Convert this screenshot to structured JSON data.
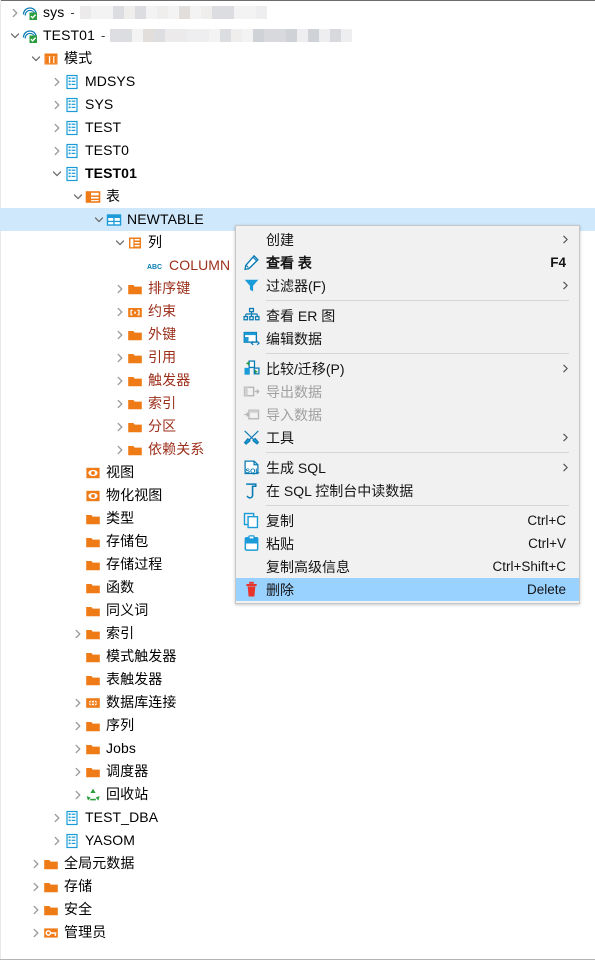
{
  "window": {
    "title": "Database Navigator",
    "selection_color": "#cfe8fc",
    "menu_highlight_color": "#99d1ff",
    "accent_orange": "#ef7b16",
    "accent_blue": "#1b9bd8",
    "schema_text_color": "#9c2f1b"
  },
  "tree": {
    "items": [
      {
        "label": "sys",
        "indent": 0,
        "twisty": "collapsed",
        "icon": "connection-icon",
        "bold": false,
        "red": false,
        "censored": true,
        "dash": true
      },
      {
        "label": "TEST01",
        "indent": 0,
        "twisty": "expanded",
        "icon": "connection-icon",
        "bold": false,
        "red": false,
        "censored": true,
        "dash": true
      },
      {
        "label": "模式",
        "indent": 1,
        "twisty": "expanded",
        "icon": "schemas-folder-icon",
        "bold": false,
        "red": false,
        "censored": false,
        "dash": false
      },
      {
        "label": "MDSYS",
        "indent": 2,
        "twisty": "collapsed",
        "icon": "schema-icon",
        "bold": false,
        "red": false,
        "censored": false,
        "dash": false
      },
      {
        "label": "SYS",
        "indent": 2,
        "twisty": "collapsed",
        "icon": "schema-icon",
        "bold": false,
        "red": false,
        "censored": false,
        "dash": false
      },
      {
        "label": "TEST",
        "indent": 2,
        "twisty": "collapsed",
        "icon": "schema-icon",
        "bold": false,
        "red": false,
        "censored": false,
        "dash": false
      },
      {
        "label": "TEST0",
        "indent": 2,
        "twisty": "collapsed",
        "icon": "schema-icon",
        "bold": false,
        "red": false,
        "censored": false,
        "dash": false
      },
      {
        "label": "TEST01",
        "indent": 2,
        "twisty": "expanded",
        "icon": "schema-icon",
        "bold": true,
        "red": false,
        "censored": false,
        "dash": false
      },
      {
        "label": "表",
        "indent": 3,
        "twisty": "expanded",
        "icon": "tables-folder-icon",
        "bold": false,
        "red": false,
        "censored": false,
        "dash": false
      },
      {
        "label": "NEWTABLE",
        "indent": 4,
        "twisty": "expanded",
        "icon": "table-icon",
        "bold": false,
        "red": false,
        "censored": false,
        "dash": false,
        "selected": true
      },
      {
        "label": "列",
        "indent": 5,
        "twisty": "expanded",
        "icon": "columns-folder-icon",
        "bold": false,
        "red": false,
        "censored": false,
        "dash": false
      },
      {
        "label": "COLUMN",
        "indent": 6,
        "twisty": "none",
        "icon": "abc-icon",
        "bold": false,
        "red": true,
        "censored": false,
        "dash": false
      },
      {
        "label": "排序键",
        "indent": 5,
        "twisty": "collapsed",
        "icon": "folder-icon",
        "bold": false,
        "red": true,
        "censored": false,
        "dash": false
      },
      {
        "label": "约束",
        "indent": 5,
        "twisty": "collapsed",
        "icon": "constraint-icon",
        "bold": false,
        "red": true,
        "censored": false,
        "dash": false
      },
      {
        "label": "外键",
        "indent": 5,
        "twisty": "collapsed",
        "icon": "folder-icon",
        "bold": false,
        "red": true,
        "censored": false,
        "dash": false
      },
      {
        "label": "引用",
        "indent": 5,
        "twisty": "collapsed",
        "icon": "folder-icon",
        "bold": false,
        "red": true,
        "censored": false,
        "dash": false
      },
      {
        "label": "触发器",
        "indent": 5,
        "twisty": "collapsed",
        "icon": "folder-icon",
        "bold": false,
        "red": true,
        "censored": false,
        "dash": false
      },
      {
        "label": "索引",
        "indent": 5,
        "twisty": "collapsed",
        "icon": "folder-icon",
        "bold": false,
        "red": true,
        "censored": false,
        "dash": false
      },
      {
        "label": "分区",
        "indent": 5,
        "twisty": "collapsed",
        "icon": "folder-icon",
        "bold": false,
        "red": true,
        "censored": false,
        "dash": false
      },
      {
        "label": "依赖关系",
        "indent": 5,
        "twisty": "collapsed",
        "icon": "folder-icon",
        "bold": false,
        "red": true,
        "censored": false,
        "dash": false
      },
      {
        "label": "视图",
        "indent": 3,
        "twisty": "none",
        "icon": "view-icon",
        "bold": false,
        "red": false,
        "censored": false,
        "dash": false
      },
      {
        "label": "物化视图",
        "indent": 3,
        "twisty": "none",
        "icon": "view-icon",
        "bold": false,
        "red": false,
        "censored": false,
        "dash": false
      },
      {
        "label": "类型",
        "indent": 3,
        "twisty": "none",
        "icon": "folder-icon",
        "bold": false,
        "red": false,
        "censored": false,
        "dash": false
      },
      {
        "label": "存储包",
        "indent": 3,
        "twisty": "none",
        "icon": "folder-icon",
        "bold": false,
        "red": false,
        "censored": false,
        "dash": false
      },
      {
        "label": "存储过程",
        "indent": 3,
        "twisty": "none",
        "icon": "folder-icon",
        "bold": false,
        "red": false,
        "censored": false,
        "dash": false
      },
      {
        "label": "函数",
        "indent": 3,
        "twisty": "none",
        "icon": "folder-icon",
        "bold": false,
        "red": false,
        "censored": false,
        "dash": false
      },
      {
        "label": "同义词",
        "indent": 3,
        "twisty": "none",
        "icon": "folder-icon",
        "bold": false,
        "red": false,
        "censored": false,
        "dash": false
      },
      {
        "label": "索引",
        "indent": 3,
        "twisty": "collapsed",
        "icon": "folder-icon",
        "bold": false,
        "red": false,
        "censored": false,
        "dash": false
      },
      {
        "label": "模式触发器",
        "indent": 3,
        "twisty": "none",
        "icon": "folder-icon",
        "bold": false,
        "red": false,
        "censored": false,
        "dash": false
      },
      {
        "label": "表触发器",
        "indent": 3,
        "twisty": "none",
        "icon": "folder-icon",
        "bold": false,
        "red": false,
        "censored": false,
        "dash": false
      },
      {
        "label": "数据库连接",
        "indent": 3,
        "twisty": "collapsed",
        "icon": "dblink-icon",
        "bold": false,
        "red": false,
        "censored": false,
        "dash": false
      },
      {
        "label": "序列",
        "indent": 3,
        "twisty": "collapsed",
        "icon": "folder-icon",
        "bold": false,
        "red": false,
        "censored": false,
        "dash": false
      },
      {
        "label": "Jobs",
        "indent": 3,
        "twisty": "collapsed",
        "icon": "folder-icon",
        "bold": false,
        "red": false,
        "censored": false,
        "dash": false
      },
      {
        "label": "调度器",
        "indent": 3,
        "twisty": "collapsed",
        "icon": "folder-icon",
        "bold": false,
        "red": false,
        "censored": false,
        "dash": false
      },
      {
        "label": "回收站",
        "indent": 3,
        "twisty": "collapsed",
        "icon": "recycle-icon",
        "bold": false,
        "red": false,
        "censored": false,
        "dash": false
      },
      {
        "label": "TEST_DBA",
        "indent": 2,
        "twisty": "collapsed",
        "icon": "schema-icon",
        "bold": false,
        "red": false,
        "censored": false,
        "dash": false
      },
      {
        "label": "YASOM",
        "indent": 2,
        "twisty": "collapsed",
        "icon": "schema-icon",
        "bold": false,
        "red": false,
        "censored": false,
        "dash": false
      },
      {
        "label": "全局元数据",
        "indent": 1,
        "twisty": "collapsed",
        "icon": "folder-icon",
        "bold": false,
        "red": false,
        "censored": false,
        "dash": false
      },
      {
        "label": "存储",
        "indent": 1,
        "twisty": "collapsed",
        "icon": "folder-icon",
        "bold": false,
        "red": false,
        "censored": false,
        "dash": false
      },
      {
        "label": "安全",
        "indent": 1,
        "twisty": "collapsed",
        "icon": "folder-icon",
        "bold": false,
        "red": false,
        "censored": false,
        "dash": false
      },
      {
        "label": "管理员",
        "indent": 1,
        "twisty": "collapsed",
        "icon": "admin-icon",
        "bold": false,
        "red": false,
        "censored": false,
        "dash": false
      }
    ]
  },
  "context_menu": {
    "items": [
      {
        "type": "item",
        "label": "创建",
        "icon": null,
        "accel": "",
        "arrow": true,
        "bold": false,
        "disabled": false,
        "highlight": false
      },
      {
        "type": "item",
        "label": "查看 表",
        "icon": "pencil-icon",
        "accel": "F4",
        "arrow": false,
        "bold": true,
        "disabled": false,
        "highlight": false
      },
      {
        "type": "item",
        "label": "过滤器(F)",
        "icon": "filter-icon",
        "accel": "",
        "arrow": true,
        "bold": false,
        "disabled": false,
        "highlight": false
      },
      {
        "type": "separator"
      },
      {
        "type": "item",
        "label": "查看 ER 图",
        "icon": "er-diagram-icon",
        "accel": "",
        "arrow": false,
        "bold": false,
        "disabled": false,
        "highlight": false
      },
      {
        "type": "item",
        "label": "编辑数据",
        "icon": "edit-data-icon",
        "accel": "",
        "arrow": false,
        "bold": false,
        "disabled": false,
        "highlight": false
      },
      {
        "type": "separator"
      },
      {
        "type": "item",
        "label": "比较/迁移(P)",
        "icon": "compare-icon",
        "accel": "",
        "arrow": true,
        "bold": false,
        "disabled": false,
        "highlight": false
      },
      {
        "type": "item",
        "label": "导出数据",
        "icon": "export-icon",
        "accel": "",
        "arrow": false,
        "bold": false,
        "disabled": true,
        "highlight": false
      },
      {
        "type": "item",
        "label": "导入数据",
        "icon": "import-icon",
        "accel": "",
        "arrow": false,
        "bold": false,
        "disabled": true,
        "highlight": false
      },
      {
        "type": "item",
        "label": "工具",
        "icon": "tools-icon",
        "accel": "",
        "arrow": true,
        "bold": false,
        "disabled": false,
        "highlight": false
      },
      {
        "type": "separator"
      },
      {
        "type": "item",
        "label": "生成 SQL",
        "icon": "sql-gen-icon",
        "accel": "",
        "arrow": true,
        "bold": false,
        "disabled": false,
        "highlight": false
      },
      {
        "type": "item",
        "label": "在 SQL 控制台中读数据",
        "icon": "sql-console-icon",
        "accel": "",
        "arrow": false,
        "bold": false,
        "disabled": false,
        "highlight": false
      },
      {
        "type": "separator"
      },
      {
        "type": "item",
        "label": "复制",
        "icon": "copy-icon",
        "accel": "Ctrl+C",
        "arrow": false,
        "bold": false,
        "disabled": false,
        "highlight": false
      },
      {
        "type": "item",
        "label": "粘贴",
        "icon": "paste-icon",
        "accel": "Ctrl+V",
        "arrow": false,
        "bold": false,
        "disabled": false,
        "highlight": false
      },
      {
        "type": "item",
        "label": "复制高级信息",
        "icon": null,
        "accel": "Ctrl+Shift+C",
        "arrow": false,
        "bold": false,
        "disabled": false,
        "highlight": false
      },
      {
        "type": "item",
        "label": "删除",
        "icon": "delete-icon",
        "accel": "Delete",
        "arrow": false,
        "bold": false,
        "disabled": false,
        "highlight": true
      }
    ]
  }
}
